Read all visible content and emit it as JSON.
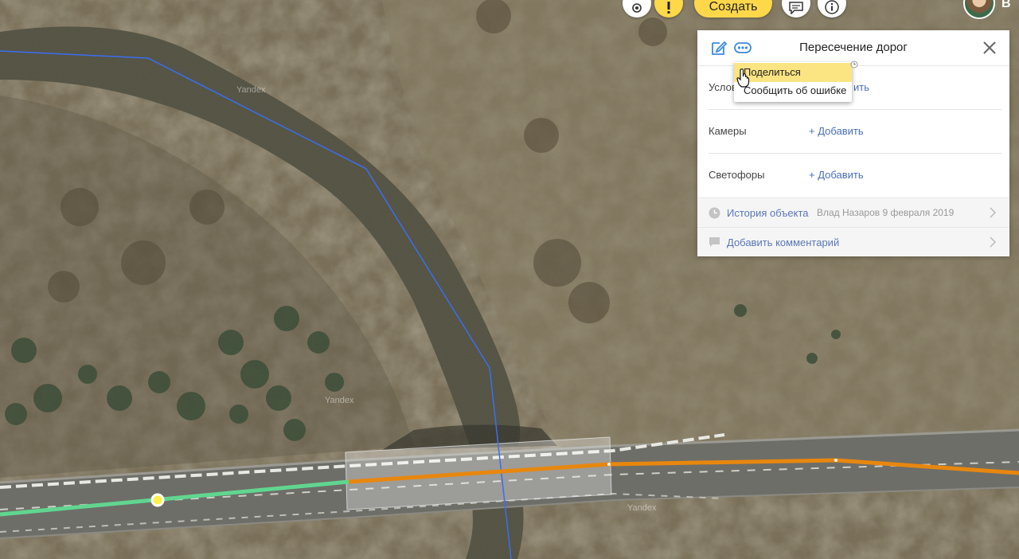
{
  "map": {
    "watermark": "Yandex"
  },
  "toolbar": {
    "create_label": "Создать",
    "user_initial": "В"
  },
  "panel": {
    "title": "Пересечение дорог",
    "rows": [
      {
        "label": "Услов",
        "add_label": "ить"
      },
      {
        "label": "Камеры",
        "add_label": "+ Добавить"
      },
      {
        "label": "Светофоры",
        "add_label": "+ Добавить"
      }
    ],
    "history": {
      "label": "История объекта",
      "author_date": "Влад Назаров 9 февраля 2019"
    },
    "comment": {
      "label": "Добавить комментарий"
    }
  },
  "menu": {
    "items": [
      {
        "label": "Поделиться",
        "highlighted": true
      },
      {
        "label": "Сообщить об ошибке",
        "highlighted": false
      }
    ]
  },
  "colors": {
    "accent_yellow": "#ffd84a",
    "road_orange": "#e8870e",
    "road_green": "#5fd08a",
    "link_blue": "#4a6fb5"
  }
}
